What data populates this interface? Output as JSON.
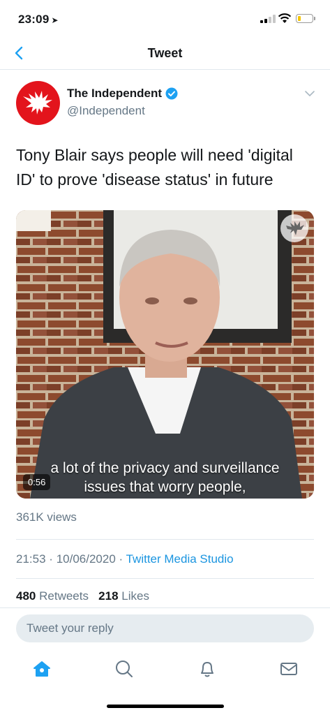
{
  "status_bar": {
    "time": "23:09",
    "location_glyph": "➤",
    "battery_color": "#f5c400"
  },
  "nav": {
    "title": "Tweet",
    "back_icon": "chevron-left-icon"
  },
  "tweet": {
    "author_name": "The Independent",
    "author_handle": "@Independent",
    "verified": true,
    "text": "Tony Blair says people will need 'digital ID' to prove 'disease status' in future",
    "video": {
      "subtitle_line1": "a lot of the privacy and surveillance",
      "subtitle_line2": "issues that worry people,",
      "duration": "0:56"
    },
    "views": "361K views",
    "time": "21:53",
    "date": "10/06/2020",
    "separator": "·",
    "source": "Twitter Media Studio",
    "retweets_count": "480",
    "retweets_label": "Retweets",
    "likes_count": "218",
    "likes_label": "Likes"
  },
  "reply": {
    "placeholder": "Tweet your reply"
  },
  "tabbar": {
    "items": [
      "home-icon",
      "search-icon",
      "notifications-icon",
      "messages-icon"
    ]
  },
  "colors": {
    "accent": "#1da1f2",
    "brand_red": "#e3141c",
    "secondary_text": "#657786",
    "divider": "#e1e8ed"
  }
}
